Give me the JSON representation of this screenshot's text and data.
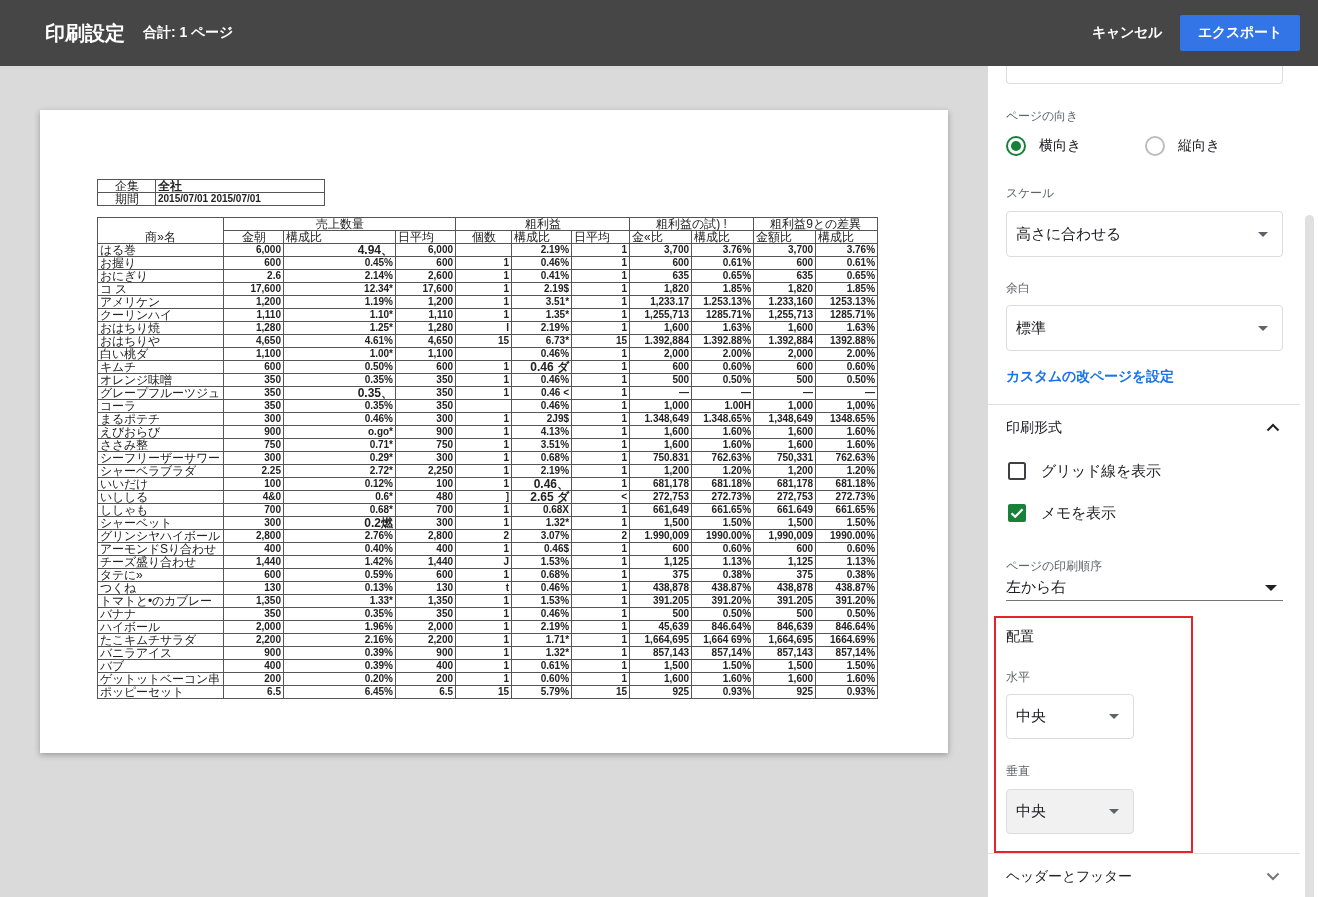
{
  "header": {
    "title": "印刷設定",
    "total": "合計: 1 ページ",
    "cancel": "キャンセル",
    "export": "エクスポート"
  },
  "preview": {
    "info": [
      {
        "label": "企集",
        "value": "全社"
      },
      {
        "label": "期間",
        "value": "2015/07/01 2015/07/01"
      }
    ],
    "table": {
      "name_header": "商»名",
      "groups": [
        {
          "label": "売上数量",
          "columns": [
            "金朝",
            "構成比",
            "日平均"
          ]
        },
        {
          "label": "粗利益",
          "columns": [
            "個数",
            "構成比",
            "日平均"
          ]
        },
        {
          "label": "粗利益の試) !",
          "columns": [
            "金«比",
            "構成比"
          ]
        },
        {
          "label": "粗利益9との差異",
          "columns": [
            "金額比",
            "構成比"
          ]
        }
      ],
      "rows": [
        {
          "name": "はる巻",
          "cells": [
            "6,000",
            "4.94、",
            "6,000",
            null,
            "2.19%",
            "1",
            "3,700",
            "3.76%",
            "3,700",
            "3.76%"
          ]
        },
        {
          "name": "お握り",
          "cells": [
            "600",
            "0.45%",
            "600",
            "1",
            "0.46%",
            "1",
            "600",
            "0.61%",
            "600",
            "0.61%"
          ]
        },
        {
          "name": "おにぎり",
          "cells": [
            "2.6",
            "2.14%",
            "2,600",
            "1",
            "0.41%",
            "1",
            "635",
            "0.65%",
            "635",
            "0.65%"
          ]
        },
        {
          "name": "コ ス",
          "cells": [
            "17,600",
            "12.34*",
            "17,600",
            "1",
            "2.19$",
            "1",
            "1,820",
            "1.85%",
            "1,820",
            "1.85%"
          ]
        },
        {
          "name": "アメリケン",
          "cells": [
            "1,200",
            "1.19%",
            "1,200",
            "1",
            "3.51*",
            "1",
            "1,233.17",
            "1.253.13%",
            "1.233,160",
            "1253.13%"
          ]
        },
        {
          "name": "クーリンハイ",
          "cells": [
            "1,110",
            "1.10*",
            "1,110",
            "1",
            "1.35*",
            "1",
            "1,255,713",
            "1285.71%",
            "1,255,713",
            "1285.71%"
          ]
        },
        {
          "name": "おはちり焼",
          "cells": [
            "1,280",
            "1.25*",
            "1,280",
            "I",
            "2.19%",
            "1",
            "1,600",
            "1.63%",
            "1,600",
            "1.63%"
          ]
        },
        {
          "name": "おはちりや",
          "cells": [
            "4,650",
            "4.61%",
            "4,650",
            "15",
            "6.73*",
            "15",
            "1.392,884",
            "1.392.88%",
            "1.392,884",
            "1392.88%"
          ]
        },
        {
          "name": "白い桃ダ",
          "cells": [
            "1,100",
            "1.00*",
            "1,100",
            null,
            "0.46%",
            "1",
            "2,000",
            "2.00%",
            "2,000",
            "2.00%"
          ]
        },
        {
          "name": "キムチ",
          "cells": [
            "600",
            "0.50%",
            "600",
            "1",
            "0.46 ダ",
            "1",
            "600",
            "0.60%",
            "600",
            "0.60%"
          ]
        },
        {
          "name": "オレンジ味噌",
          "cells": [
            "350",
            "0.35%",
            "350",
            "1",
            "0.46%",
            "1",
            "500",
            "0.50%",
            "500",
            "0.50%"
          ]
        },
        {
          "name": "グレープフルーツジュ",
          "cells": [
            "350",
            "0.35、",
            "350",
            "1",
            "0.46 <",
            "1",
            "—",
            "—",
            "—",
            "—"
          ]
        },
        {
          "name": "コーラ",
          "cells": [
            "350",
            "0.35%",
            "350",
            null,
            "0.46%",
            "1",
            "1,000",
            "1.00H",
            "1,000",
            "1,00%"
          ]
        },
        {
          "name": "まるポテチ",
          "cells": [
            "300",
            "0.46%",
            "300",
            "1",
            "2J9$",
            "1",
            "1.348,649",
            "1.348.65%",
            "1,348,649",
            "1348.65%"
          ]
        },
        {
          "name": "えびおらび",
          "cells": [
            "900",
            "o.go*",
            "900",
            "1",
            "4.13%",
            "1",
            "1,600",
            "1.60%",
            "1,600",
            "1.60%"
          ]
        },
        {
          "name": "ささみ整",
          "cells": [
            "750",
            "0.71*",
            "750",
            "1",
            "3.51%",
            "1",
            "1,600",
            "1.60%",
            "1,600",
            "1.60%"
          ]
        },
        {
          "name": "シーフリーザーサワー",
          "cells": [
            "300",
            "0.29*",
            "300",
            "1",
            "0.68%",
            "1",
            "750.831",
            "762.63%",
            "750,331",
            "762.63%"
          ]
        },
        {
          "name": "シャーベラブラダ",
          "cells": [
            "2.25",
            "2.72*",
            "2,250",
            "1",
            "2.19%",
            "1",
            "1,200",
            "1.20%",
            "1,200",
            "1.20%"
          ]
        },
        {
          "name": "いいだけ",
          "cells": [
            "100",
            "0.12%",
            "100",
            "1",
            "0.46、",
            "1",
            "681,178",
            "681.18%",
            "681,178",
            "681.18%"
          ]
        },
        {
          "name": "いししる",
          "cells": [
            "4&0",
            "0.6*",
            "480",
            "]",
            "2.65 ダ",
            "<",
            "272,753",
            "272.73%",
            "272,753",
            "272.73%"
          ]
        },
        {
          "name": "ししゃも",
          "cells": [
            "700",
            "0.68*",
            "700",
            "1",
            "0.68X",
            "1",
            "661,649",
            "661.65%",
            "661.649",
            "661.65%"
          ]
        },
        {
          "name": "シャーベット",
          "cells": [
            "300",
            "0.2燃",
            "300",
            "1",
            "1.32*",
            "1",
            "1,500",
            "1.50%",
            "1,500",
            "1.50%"
          ]
        },
        {
          "name": "グリンシヤハイボール",
          "cells": [
            "2,800",
            "2.76%",
            "2,800",
            "2",
            "3.07%",
            "2",
            "1.990,009",
            "1990.00%",
            "1,990,009",
            "1990.00%"
          ]
        },
        {
          "name": "アーモンドSり合わせ",
          "cells": [
            "400",
            "0.40%",
            "400",
            "1",
            "0.46$",
            "1",
            "600",
            "0.60%",
            "600",
            "0.60%"
          ]
        },
        {
          "name": "チーズ盛り合わせ",
          "cells": [
            "1,440",
            "1.42%",
            "1,440",
            "J",
            "1.53%",
            "1",
            "1,125",
            "1.13%",
            "1,125",
            "1.13%"
          ]
        },
        {
          "name": "タテに»",
          "cells": [
            "600",
            "0.59%",
            "600",
            "1",
            "0.68%",
            "1",
            "375",
            "0.38%",
            "375",
            "0.38%"
          ]
        },
        {
          "name": "つくね",
          "cells": [
            "130",
            "0.13%",
            "130",
            "t",
            "0.46%",
            "1",
            "438,878",
            "438.87%",
            "438,878",
            "438.87%"
          ]
        },
        {
          "name": "トマトと•のカブレー",
          "cells": [
            "1,350",
            "1.33*",
            "1,350",
            "1",
            "1.53%",
            "1",
            "391.205",
            "391.20%",
            "391.205",
            "391.20%"
          ]
        },
        {
          "name": "バナナ",
          "cells": [
            "350",
            "0.35%",
            "350",
            "1",
            "0.46%",
            "1",
            "500",
            "0.50%",
            "500",
            "0.50%"
          ]
        },
        {
          "name": "ハイボール",
          "cells": [
            "2,000",
            "1.96%",
            "2,000",
            "1",
            "2.19%",
            "1",
            "45,639",
            "846.64%",
            "846,639",
            "846.64%"
          ]
        },
        {
          "name": "たこキムチサラダ",
          "cells": [
            "2,200",
            "2.16%",
            "2,200",
            "1",
            "1.71*",
            "1",
            "1,664,695",
            "1,664 69%",
            "1,664,695",
            "1664.69%"
          ]
        },
        {
          "name": "バニラアイス",
          "cells": [
            "900",
            "0.39%",
            "900",
            "1",
            "1.32*",
            "1",
            "857,143",
            "857,14%",
            "857,143",
            "857,14%"
          ]
        },
        {
          "name": "バブ",
          "cells": [
            "400",
            "0.39%",
            "400",
            "1",
            "0.61%",
            "1",
            "1,500",
            "1.50%",
            "1,500",
            "1.50%"
          ]
        },
        {
          "name": "ゲットットベーコン串",
          "cells": [
            "200",
            "0.20%",
            "200",
            "1",
            "0.60%",
            "1",
            "1,600",
            "1.60%",
            "1,600",
            "1.60%"
          ]
        },
        {
          "name": "ポッピーセット",
          "cells": [
            "6.5",
            "6.45%",
            "6.5",
            "15",
            "5.79%",
            "15",
            "925",
            "0.93%",
            "925",
            "0.93%"
          ]
        }
      ]
    }
  },
  "settings": {
    "orientation": {
      "label": "ページの向き",
      "options": [
        {
          "label": "横向き",
          "selected": true
        },
        {
          "label": "縦向き",
          "selected": false
        }
      ]
    },
    "scale": {
      "label": "スケール",
      "value": "高さに合わせる"
    },
    "margins": {
      "label": "余白",
      "value": "標準"
    },
    "custom_breaks_link": "カスタムの改ページを設定",
    "format": {
      "title": "印刷形式",
      "expanded": true,
      "checkboxes": [
        {
          "label": "グリッド線を表示",
          "checked": false
        },
        {
          "label": "メモを表示",
          "checked": true
        }
      ],
      "page_order": {
        "label": "ページの印刷順序",
        "value": "左から右"
      }
    },
    "alignment": {
      "title": "配置",
      "highlighted": true,
      "horizontal": {
        "label": "水平",
        "value": "中央",
        "hovered": false
      },
      "vertical": {
        "label": "垂直",
        "value": "中央",
        "hovered": true
      }
    },
    "header_footer": {
      "title": "ヘッダーとフッター",
      "expanded": false
    }
  }
}
